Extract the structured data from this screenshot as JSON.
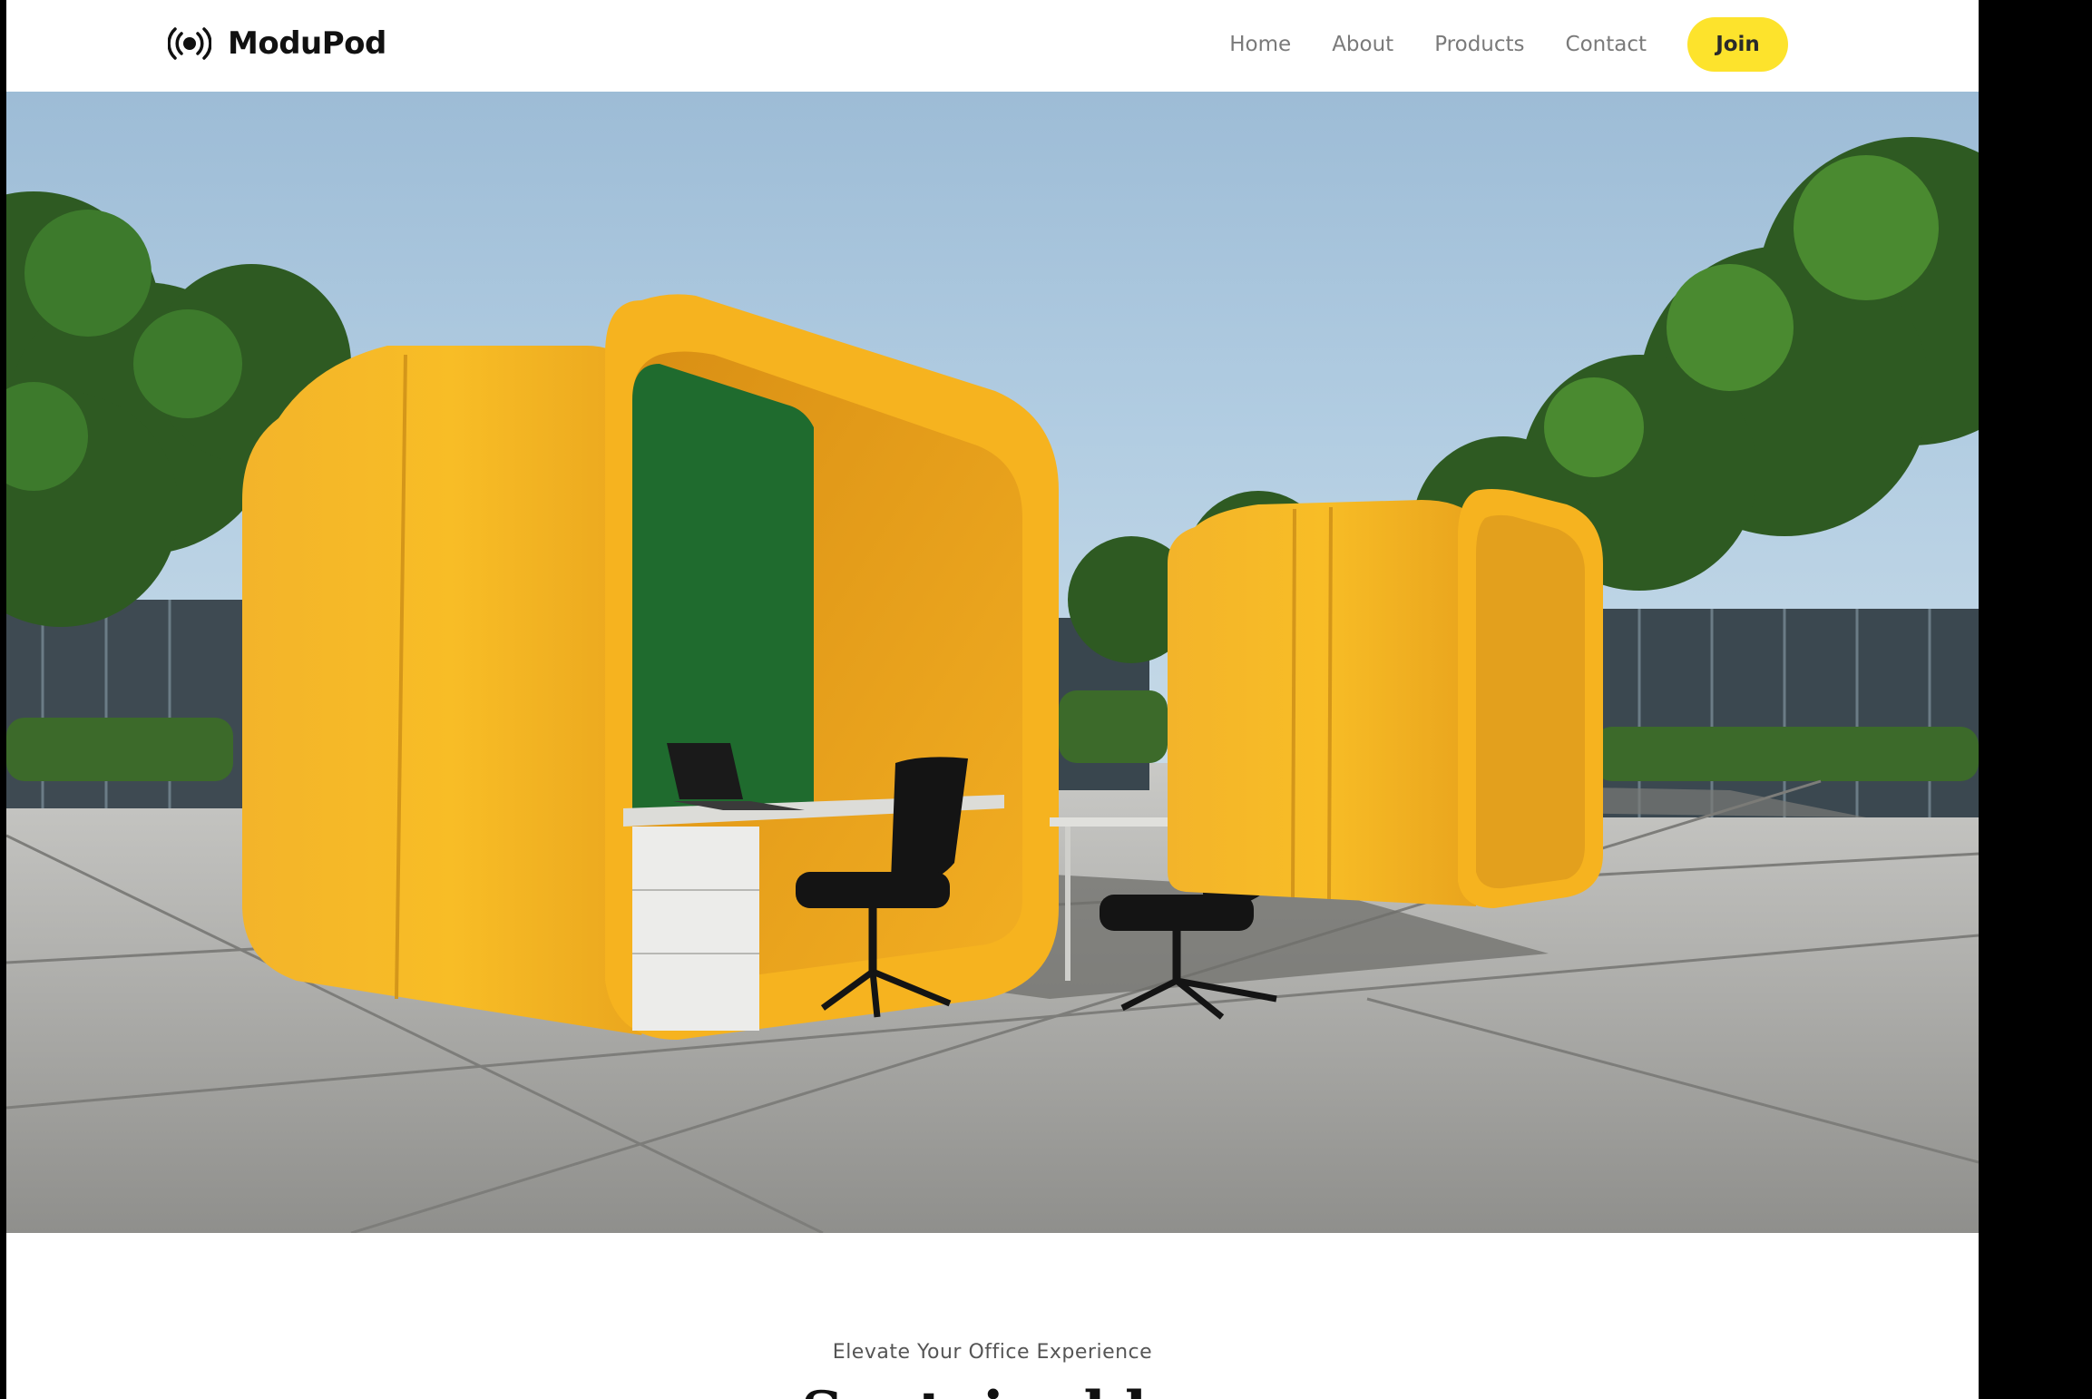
{
  "brand": {
    "name": "ModuPod",
    "icon": "broadcast-icon",
    "accent_color": "#fde32c"
  },
  "nav": {
    "items": [
      {
        "label": "Home"
      },
      {
        "label": "About"
      },
      {
        "label": "Products"
      },
      {
        "label": "Contact"
      }
    ],
    "cta_label": "Join"
  },
  "intro": {
    "eyebrow": "Elevate Your Office Experience",
    "heading": "Sustainable"
  }
}
